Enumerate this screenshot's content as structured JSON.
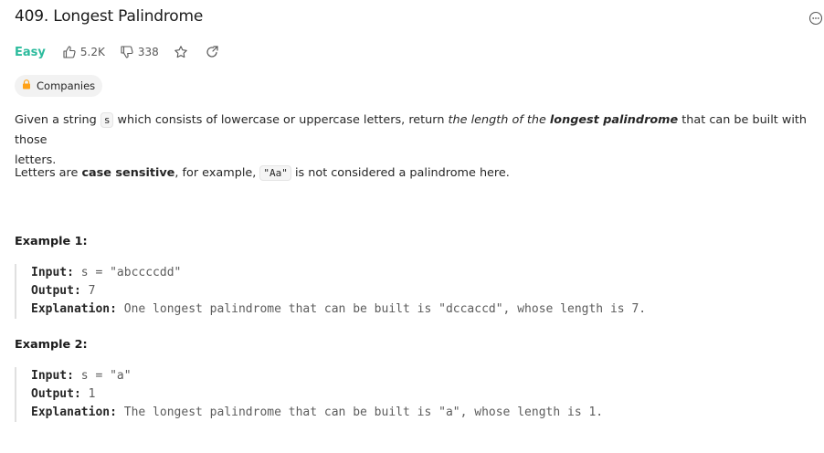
{
  "problem": {
    "title": "409. Longest Palindrome",
    "difficulty": "Easy",
    "likes": "5.2K",
    "dislikes": "338",
    "companies_label": "Companies"
  },
  "description": {
    "p1_a": "Given a string ",
    "p1_code": "s",
    "p1_b": " which consists of lowercase or uppercase letters, return ",
    "p1_em1": "the length of the ",
    "p1_strong": "longest palindrome",
    "p1_c": " that can be built with those",
    "p1_d": "letters.",
    "p2_a": "Letters are ",
    "p2_strong": "case sensitive",
    "p2_b": ", for example, ",
    "p2_code": "\"Aa\"",
    "p2_c": " is not considered a palindrome here."
  },
  "examples": [
    {
      "title": "Example 1:",
      "input_label": "Input:",
      "input": " s = \"abccccdd\"",
      "output_label": "Output:",
      "output": " 7",
      "explanation_label": "Explanation:",
      "explanation": " One longest palindrome that can be built is \"dccaccd\", whose length is 7."
    },
    {
      "title": "Example 2:",
      "input_label": "Input:",
      "input": " s = \"a\"",
      "output_label": "Output:",
      "output": " 1",
      "explanation_label": "Explanation:",
      "explanation": " The longest palindrome that can be built is \"a\", whose length is 1."
    }
  ],
  "colors": {
    "easy": "#2cbb9d",
    "lock": "#ffa116"
  },
  "icons": [
    "thumbs-up-icon",
    "thumbs-down-icon",
    "star-icon",
    "share-icon",
    "lock-icon",
    "more-icon"
  ]
}
